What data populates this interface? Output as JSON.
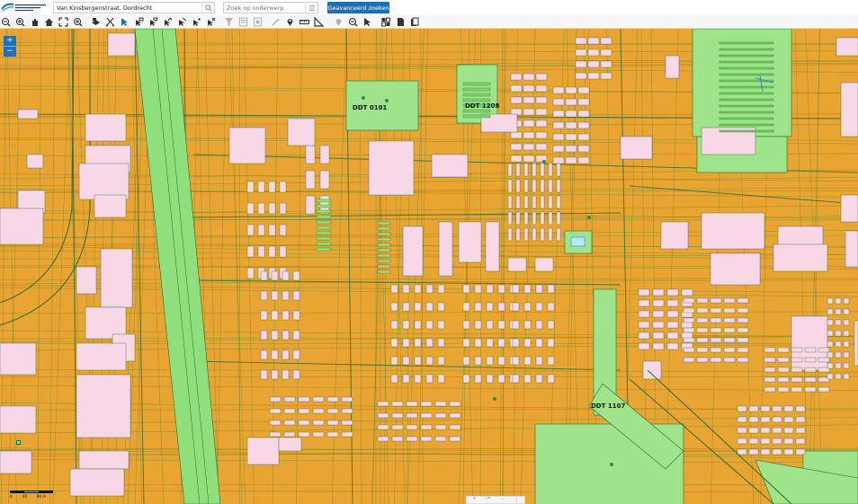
{
  "search": {
    "value": "Van Kinsbergenstraat, Dordrecht"
  },
  "subject_search": {
    "placeholder": "Zoek op onderwerp"
  },
  "advanced_search": {
    "label": "Geavanceerd zoeken"
  },
  "zoom": {
    "in_label": "+",
    "out_label": "−"
  },
  "map": {
    "labels": [
      "DDT 0101",
      "DDT 1208",
      "DDT 1107"
    ],
    "colors": {
      "built": "#e8a531",
      "parcel_line": "#2f6f2f",
      "green": "#8fe07c",
      "building": "#f8d7e6",
      "water_green": "#9fe48a",
      "line_dark": "#2d6a34"
    }
  },
  "scale": {
    "left": "0",
    "mid": "40",
    "right": "80 m"
  },
  "bottom_controls": [
    "⌃",
    "^",
    "·",
    "⋮"
  ],
  "toolbar_icons": [
    "zoom-out-icon",
    "zoom-in-icon",
    "pan-hand-icon",
    "home-icon",
    "full-extent-icon",
    "zoom-box-icon",
    "layers-icon",
    "cut-icon",
    "select-icon",
    "select-plus-icon",
    "select-minus-icon",
    "select-poly-icon",
    "select-line-icon",
    "select-point-icon",
    "select-clear-icon",
    "filter-icon",
    "report-icon",
    "report-2-icon",
    "report-3-icon",
    "pin-icon",
    "measure-line-icon",
    "measure-angle-icon",
    "marker-icon",
    "zoom-extent-icon",
    "arrow-icon",
    "basemap-icon",
    "document-icon",
    "documents-icon",
    "print-icon"
  ]
}
